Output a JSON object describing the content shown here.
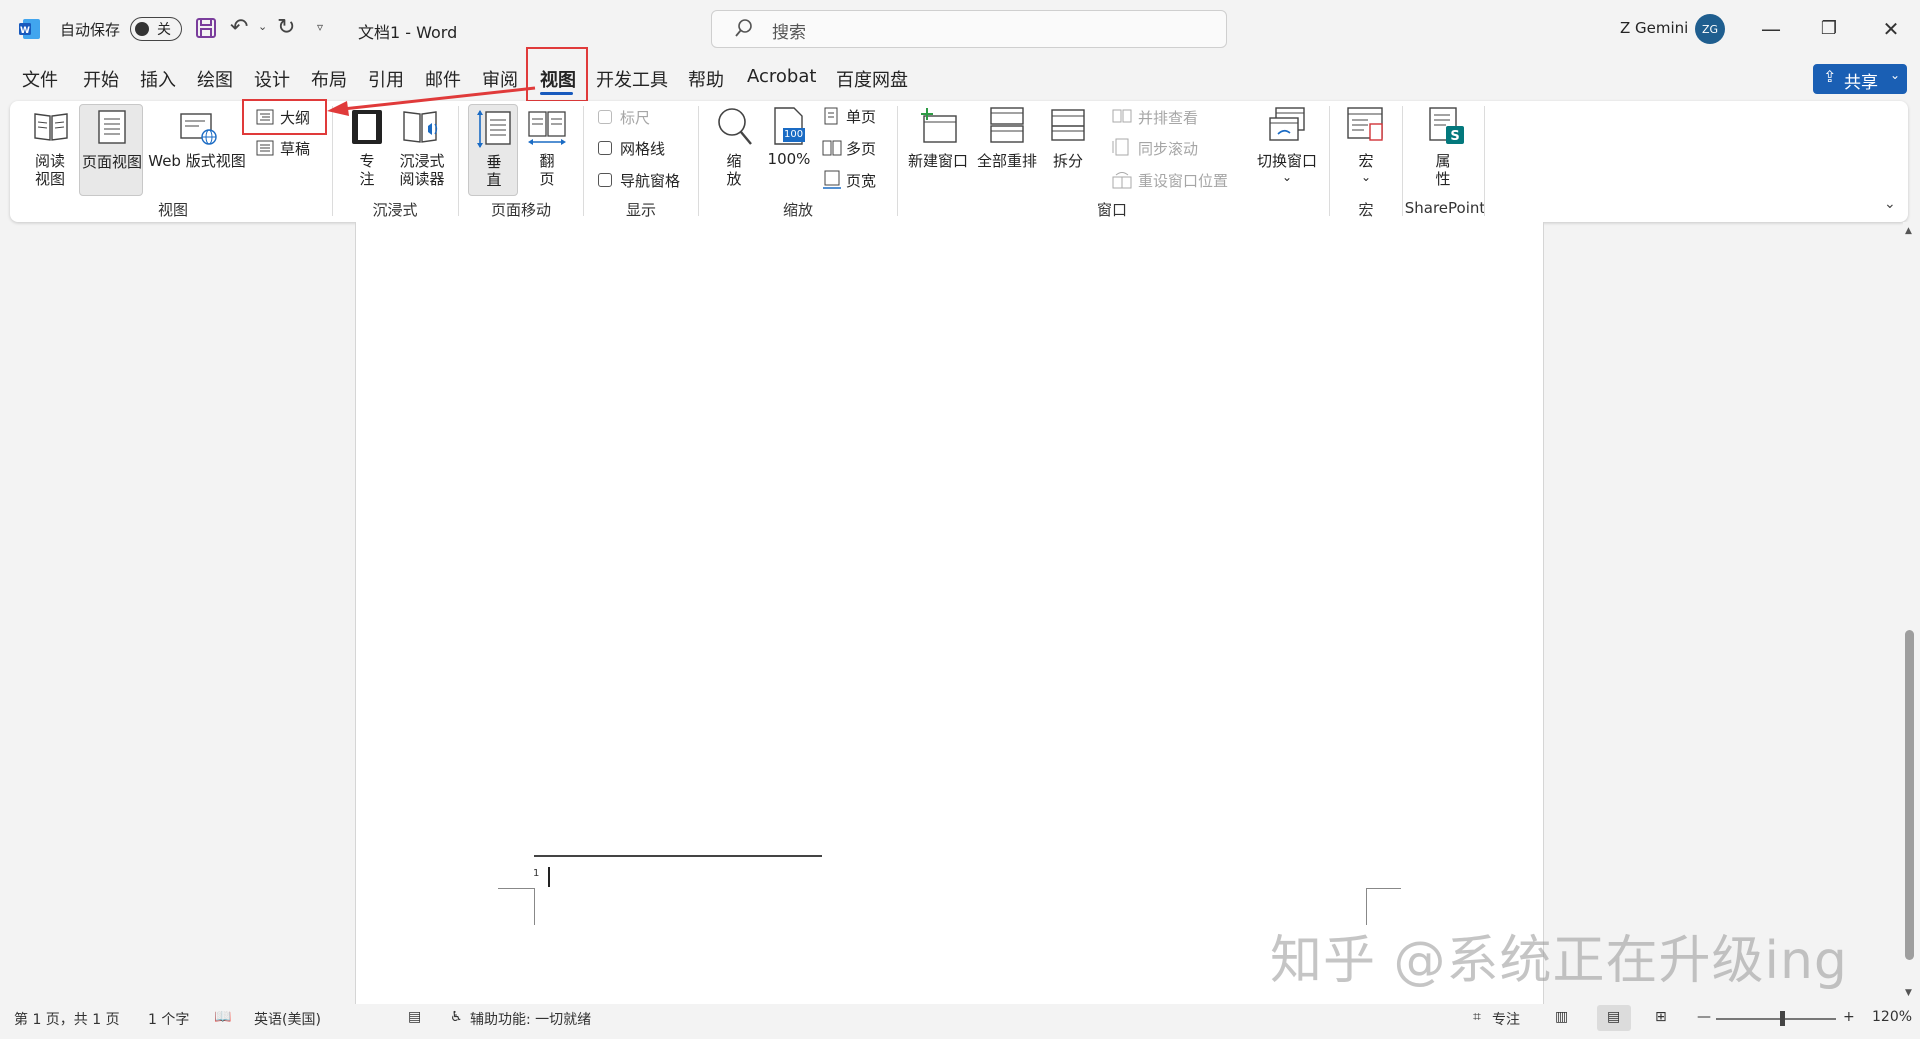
{
  "titlebar": {
    "autosave_label": "自动保存",
    "autosave_state": "关",
    "doc_title": "文档1  -  Word",
    "search_placeholder": "搜索",
    "user_name": "Z Gemini",
    "user_initials": "ZG"
  },
  "tabs": [
    "文件",
    "开始",
    "插入",
    "绘图",
    "设计",
    "布局",
    "引用",
    "邮件",
    "审阅",
    "视图",
    "开发工具",
    "帮助",
    "Acrobat",
    "百度网盘"
  ],
  "active_tab": "视图",
  "share_label": "共享",
  "ribbon": {
    "views": {
      "read": "阅读\n视图",
      "read_l1": "阅读",
      "read_l2": "视图",
      "print": "页面视图",
      "web": "Web 版式视图",
      "outline": "大纲",
      "draft": "草稿",
      "group": "视图"
    },
    "immersive": {
      "focus_l1": "专",
      "focus_l2": "注",
      "reader_l1": "沉浸式",
      "reader_l2": "阅读器",
      "group": "沉浸式"
    },
    "page_move": {
      "vertical_l1": "垂",
      "vertical_l2": "直",
      "side_l1": "翻",
      "side_l2": "页",
      "group": "页面移动"
    },
    "show": {
      "ruler": "标尺",
      "gridlines": "网格线",
      "navpane": "导航窗格",
      "group": "显示"
    },
    "zoom": {
      "zoom_l1": "缩",
      "zoom_l2": "放",
      "pct": "100%",
      "one_page": "单页",
      "multi_page": "多页",
      "page_width": "页宽",
      "icon_text": "100",
      "group": "缩放"
    },
    "window": {
      "new_window": "新建窗口",
      "arrange_all": "全部重排",
      "split": "拆分",
      "side_by_side": "并排查看",
      "sync_scroll": "同步滚动",
      "reset_pos": "重设窗口位置",
      "switch_window": "切换窗口",
      "group": "窗口"
    },
    "macros": {
      "label": "宏",
      "group": "宏"
    },
    "sharepoint": {
      "props_l1": "属",
      "props_l2": "性",
      "group": "SharePoint"
    }
  },
  "document": {
    "footnote_number": "1"
  },
  "statusbar": {
    "page": "第 1 页，共 1 页",
    "words": "1 个字",
    "language": "英语(美国)",
    "accessibility": "辅助功能: 一切就绪",
    "focus": "专注",
    "zoom_pct": "120%",
    "zoom_level": 0.55
  },
  "watermark": "知乎 @系统正在升级ing",
  "colors": {
    "accent": "#185abd",
    "share": "#1a5fb4",
    "highlight": "#e03a3a"
  }
}
